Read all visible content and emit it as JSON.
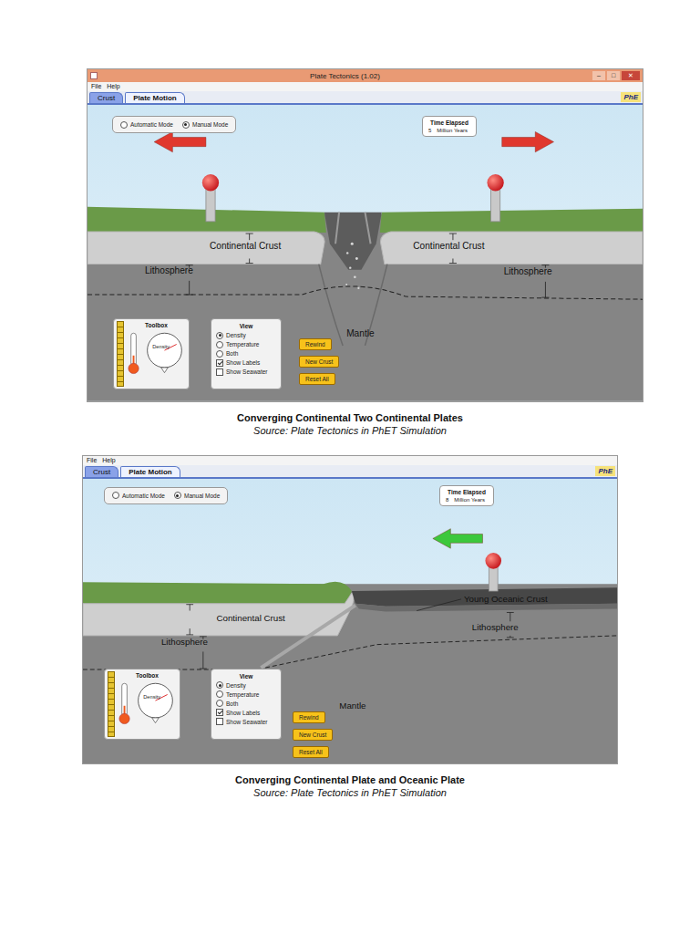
{
  "figures": [
    {
      "window": {
        "title": "Plate Tectonics (1.02)",
        "controls": [
          "–",
          "□",
          "✕"
        ]
      },
      "menu": [
        "File",
        "Help"
      ],
      "tabs": [
        {
          "label": "Crust",
          "selected": false
        },
        {
          "label": "Plate Motion",
          "selected": true
        }
      ],
      "logo": "PhE",
      "modes": [
        {
          "label": "Automatic Mode",
          "selected": false
        },
        {
          "label": "Manual Mode",
          "selected": true
        }
      ],
      "time": {
        "label": "Time Elapsed",
        "value": "5",
        "unit": "Million Years"
      },
      "scene": {
        "kind": "rift",
        "labels": {
          "left_crust": "Continental Crust",
          "right_crust": "Continental Crust",
          "left_lithosphere": "Lithosphere",
          "right_lithosphere": "Lithosphere",
          "mantle": "Mantle"
        }
      },
      "arrows": [
        {
          "direction": "left",
          "color": "#e0382e"
        },
        {
          "direction": "right",
          "color": "#e0382e"
        }
      ],
      "toolbox": {
        "title": "Toolbox",
        "meter": "Density"
      },
      "view": {
        "title": "View",
        "options": [
          {
            "label": "Density",
            "selected": true
          },
          {
            "label": "Temperature",
            "selected": false
          },
          {
            "label": "Both",
            "selected": false
          }
        ],
        "checks": [
          {
            "label": "Show Labels",
            "checked": true
          },
          {
            "label": "Show Seawater",
            "checked": false
          }
        ]
      },
      "buttons": [
        "Rewind",
        "New Crust",
        "Reset All"
      ],
      "caption": "Converging Continental Two Continental Plates",
      "source": "Source: Plate Tectonics in PhET Simulation"
    },
    {
      "menu": [
        "File",
        "Help"
      ],
      "tabs": [
        {
          "label": "Crust",
          "selected": false
        },
        {
          "label": "Plate Motion",
          "selected": true
        }
      ],
      "logo": "PhE",
      "modes": [
        {
          "label": "Automatic Mode",
          "selected": false
        },
        {
          "label": "Manual Mode",
          "selected": true
        }
      ],
      "time": {
        "label": "Time Elapsed",
        "value": "8",
        "unit": "Million Years"
      },
      "scene": {
        "kind": "subduction",
        "labels": {
          "continental_crust": "Continental Crust",
          "young_oceanic_crust": "Young Oceanic Crust",
          "left_lithosphere": "Lithosphere",
          "right_lithosphere": "Lithosphere",
          "mantle": "Mantle"
        }
      },
      "arrows": [
        {
          "direction": "left",
          "color": "#3cc83c"
        }
      ],
      "toolbox": {
        "title": "Toolbox",
        "meter": "Density"
      },
      "view": {
        "title": "View",
        "options": [
          {
            "label": "Density",
            "selected": true
          },
          {
            "label": "Temperature",
            "selected": false
          },
          {
            "label": "Both",
            "selected": false
          }
        ],
        "checks": [
          {
            "label": "Show Labels",
            "checked": true
          },
          {
            "label": "Show Seawater",
            "checked": false
          }
        ]
      },
      "buttons": [
        "Rewind",
        "New Crust",
        "Reset All"
      ],
      "caption": "Converging Continental  Plate and Oceanic Plate",
      "source": "Source: Plate Tectonics in PhET Simulation"
    }
  ]
}
